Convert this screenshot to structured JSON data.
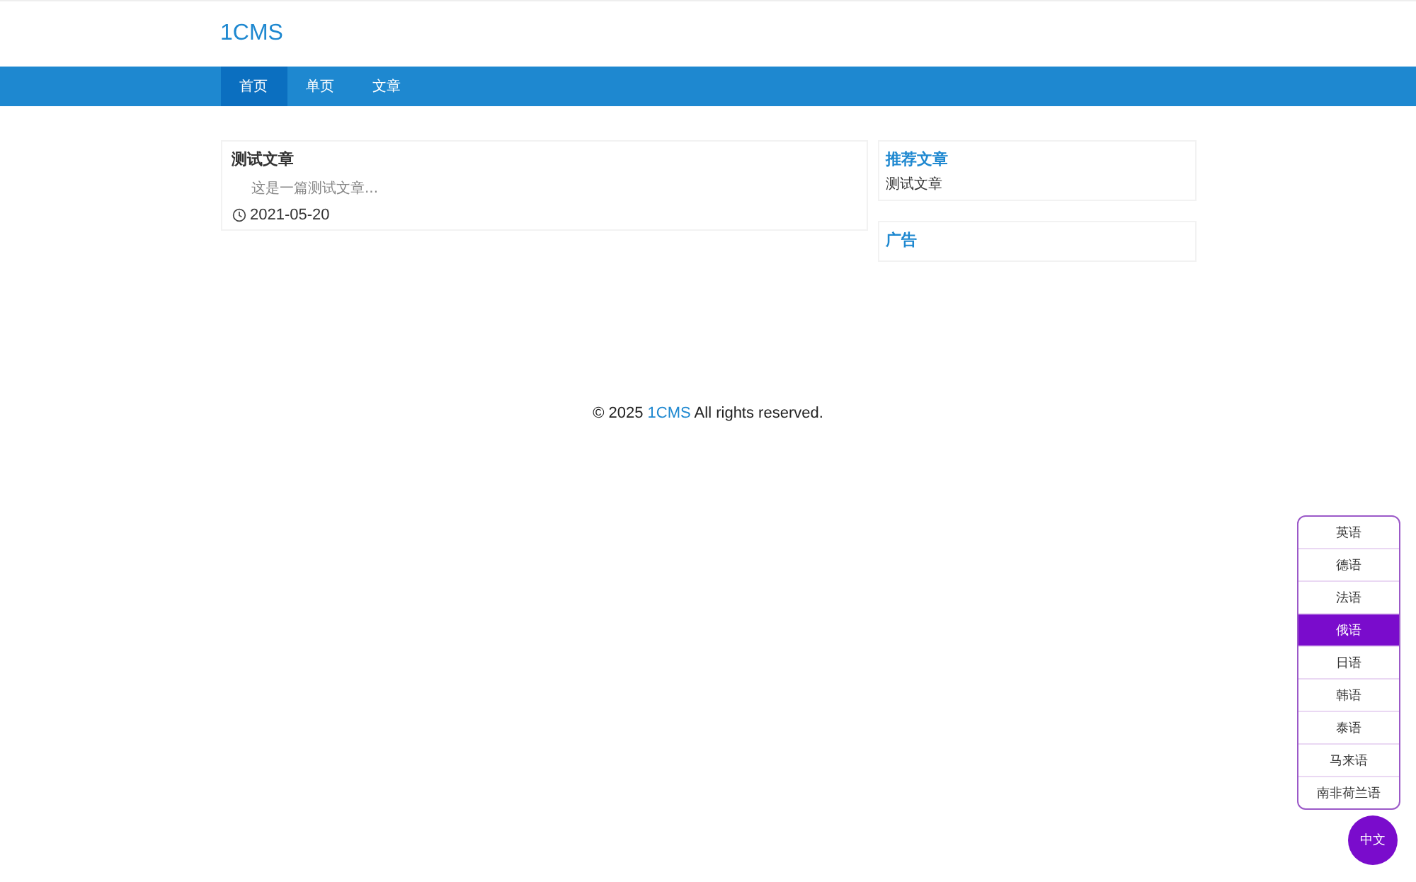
{
  "site": {
    "logo": "1CMS"
  },
  "nav": [
    {
      "label": "首页",
      "selected": true
    },
    {
      "label": "单页",
      "selected": false
    },
    {
      "label": "文章",
      "selected": false
    }
  ],
  "articles": [
    {
      "title": "测试文章",
      "summary": "这是一篇测试文章...",
      "date": "2021-05-20"
    }
  ],
  "sidebar": [
    {
      "title": "推荐文章",
      "items": [
        "测试文章"
      ]
    },
    {
      "title": "广告"
    }
  ],
  "footer": {
    "before": "© 2025 ",
    "link": "1CMS",
    "after": " All rights reserved."
  },
  "languages": [
    {
      "label": "英语",
      "selected": false
    },
    {
      "label": "德语",
      "selected": false
    },
    {
      "label": "法语",
      "selected": false
    },
    {
      "label": "俄语",
      "selected": true
    },
    {
      "label": "日语",
      "selected": false
    },
    {
      "label": "韩语",
      "selected": false
    },
    {
      "label": "泰语",
      "selected": false
    },
    {
      "label": "马来语",
      "selected": false
    },
    {
      "label": "南非荷兰语",
      "selected": false
    }
  ],
  "language_button": "中文"
}
